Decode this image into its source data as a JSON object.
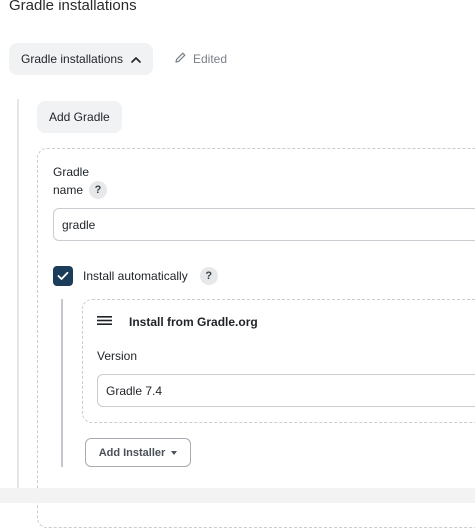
{
  "page": {
    "title": "Gradle installations"
  },
  "section": {
    "toggle_label": "Gradle installations",
    "chevron_icon": "chevron-up-icon",
    "edited_label": "Edited",
    "edited_icon": "pencil-icon"
  },
  "actions": {
    "add_gradle_label": "Add Gradle",
    "add_installer_label": "Add Installer",
    "add_installer_icon": "caret-down-icon"
  },
  "installation": {
    "name_label_line1": "Gradle",
    "name_label_line2": "name",
    "help_glyph": "?",
    "name_value": "gradle",
    "install_auto_label": "Install automatically",
    "install_auto_checked": true
  },
  "installer": {
    "title": "Install from Gradle.org",
    "drag_icon": "drag-handle-icon",
    "version_label": "Version",
    "version_value": "Gradle 7.4"
  },
  "colors": {
    "checkbox_fill": "#1c3d5a",
    "button_bg": "#f1f2f4",
    "muted_text": "#7a7f87"
  }
}
